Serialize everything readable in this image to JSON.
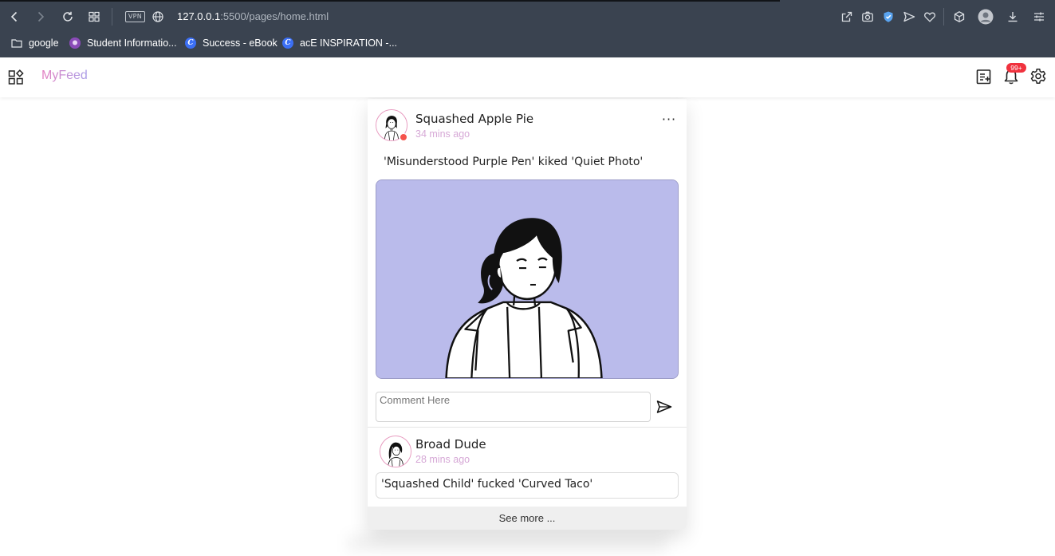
{
  "browser": {
    "url_host": "127.0.0.1",
    "url_path": ":5500/pages/home.html",
    "vpn_label": "VPN",
    "bookmarks": [
      {
        "label": "google",
        "icon": "folder-icon"
      },
      {
        "label": "Student Informatio...",
        "icon": "student-info-icon"
      },
      {
        "label": "Success - eBook",
        "icon": "c-logo-icon"
      },
      {
        "label": "acE INSPIRATION -...",
        "icon": "c-logo-icon"
      }
    ]
  },
  "header": {
    "brand": "MyFeed",
    "notification_count": "99+",
    "brand_gradient": [
      "#e37fc0",
      "#a89de8"
    ],
    "badge_color": "#f0323e"
  },
  "posts": [
    {
      "author": "Squashed Apple Pie",
      "time": "34 mins ago",
      "text": "'Misunderstood Purple Pen' kiked 'Quiet Photo'",
      "image_bg": "#babbeb",
      "online": true,
      "more_label": "···"
    },
    {
      "author": "Broad Dude",
      "time": "28 mins ago",
      "text": "'Squashed Child' fucked 'Curved Taco'"
    }
  ],
  "comment": {
    "placeholder": "Comment Here",
    "value": ""
  },
  "see_more": "See more ..."
}
